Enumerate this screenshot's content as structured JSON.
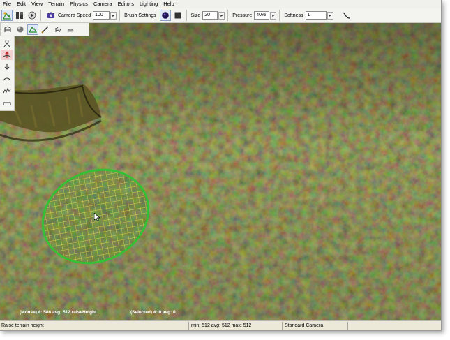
{
  "menu": [
    "File",
    "Edit",
    "View",
    "Terrain",
    "Physics",
    "Camera",
    "Editors",
    "Lighting",
    "Help"
  ],
  "toolbar": {
    "camera_speed_label": "Camera Speed",
    "camera_speed_value": "100",
    "brush_settings_label": "Brush Settings",
    "size_label": "Size",
    "size_value": "20",
    "pressure_label": "Pressure",
    "pressure_value": "40%",
    "softness_label": "Softness",
    "softness_value": "1"
  },
  "icons": {
    "main_toolbar": [
      "terrain-tool-icon",
      "layout-icon",
      "play-icon",
      "camera-icon",
      "brush-circle-icon",
      "brush-square-icon",
      "softness-curve-icon"
    ],
    "sub_toolbar": [
      "move-tool-icon",
      "sphere-icon",
      "raise-terrain-icon",
      "paint-icon",
      "foliage-icon",
      "materials-icon"
    ],
    "side_panel": [
      "raise-icon",
      "raise-height-icon",
      "lower-icon",
      "smooth-icon",
      "noise-icon",
      "flatten-icon"
    ]
  },
  "viewport": {
    "mouse_info": "(Mouse) #: 586  avg: 512 raiseHeight",
    "selected_info": "(Selected) #: 0  avg: 0"
  },
  "status": {
    "message": "Raise terrain height",
    "stats": "min: 512  avg: 512  max: 512",
    "camera": "Standard Camera"
  },
  "colors": {
    "brush_grid": "#e6d84a",
    "brush_edge": "#35c035",
    "terrain": "#4c4b27"
  }
}
